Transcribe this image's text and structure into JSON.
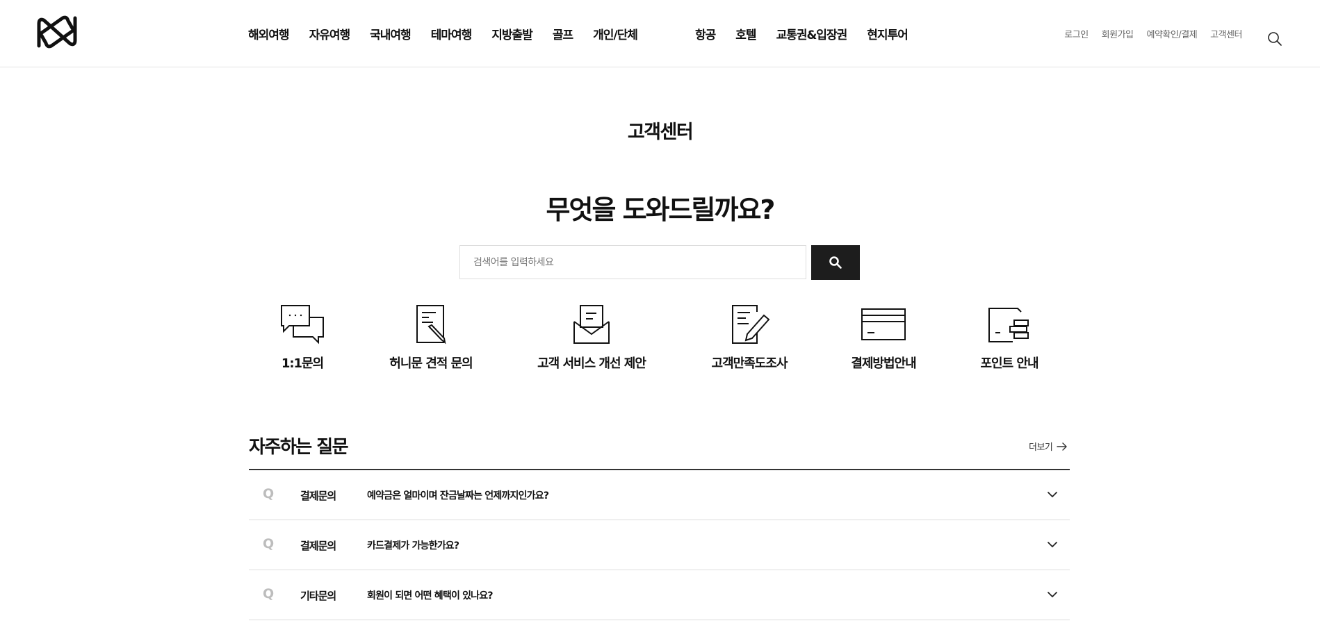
{
  "header": {
    "nav_left": [
      "해외여행",
      "자유여행",
      "국내여행",
      "테마여행",
      "지방출발",
      "골프",
      "개인/단체"
    ],
    "nav_right": [
      "항공",
      "호텔",
      "교통권&입장권",
      "현지투어"
    ],
    "util": [
      "로그인",
      "회원가입",
      "예약확인/결제",
      "고객센터"
    ]
  },
  "page": {
    "title": "고객센터",
    "hero": "무엇을 도와드릴까요?"
  },
  "search": {
    "placeholder": "검색어를 입력하세요"
  },
  "quick_menu": [
    {
      "label": "1:1문의",
      "icon": "chat-bubbles-icon"
    },
    {
      "label": "허니문 견적 문의",
      "icon": "document-pen-icon"
    },
    {
      "label": "고객 서비스 개선 제안",
      "icon": "envelope-letter-icon"
    },
    {
      "label": "고객만족도조사",
      "icon": "survey-pencil-icon"
    },
    {
      "label": "결제방법안내",
      "icon": "credit-card-icon"
    },
    {
      "label": "포인트 안내",
      "icon": "point-card-icon"
    }
  ],
  "faq": {
    "title": "자주하는 질문",
    "more": "더보기",
    "q_mark": "Q",
    "items": [
      {
        "category": "결제문의",
        "question": "예약금은 얼마이며 잔금날짜는 언제까지인가요?"
      },
      {
        "category": "결제문의",
        "question": "카드결제가 가능한가요?"
      },
      {
        "category": "기타문의",
        "question": "회원이 되면 어떤 혜택이 있나요?"
      }
    ]
  }
}
